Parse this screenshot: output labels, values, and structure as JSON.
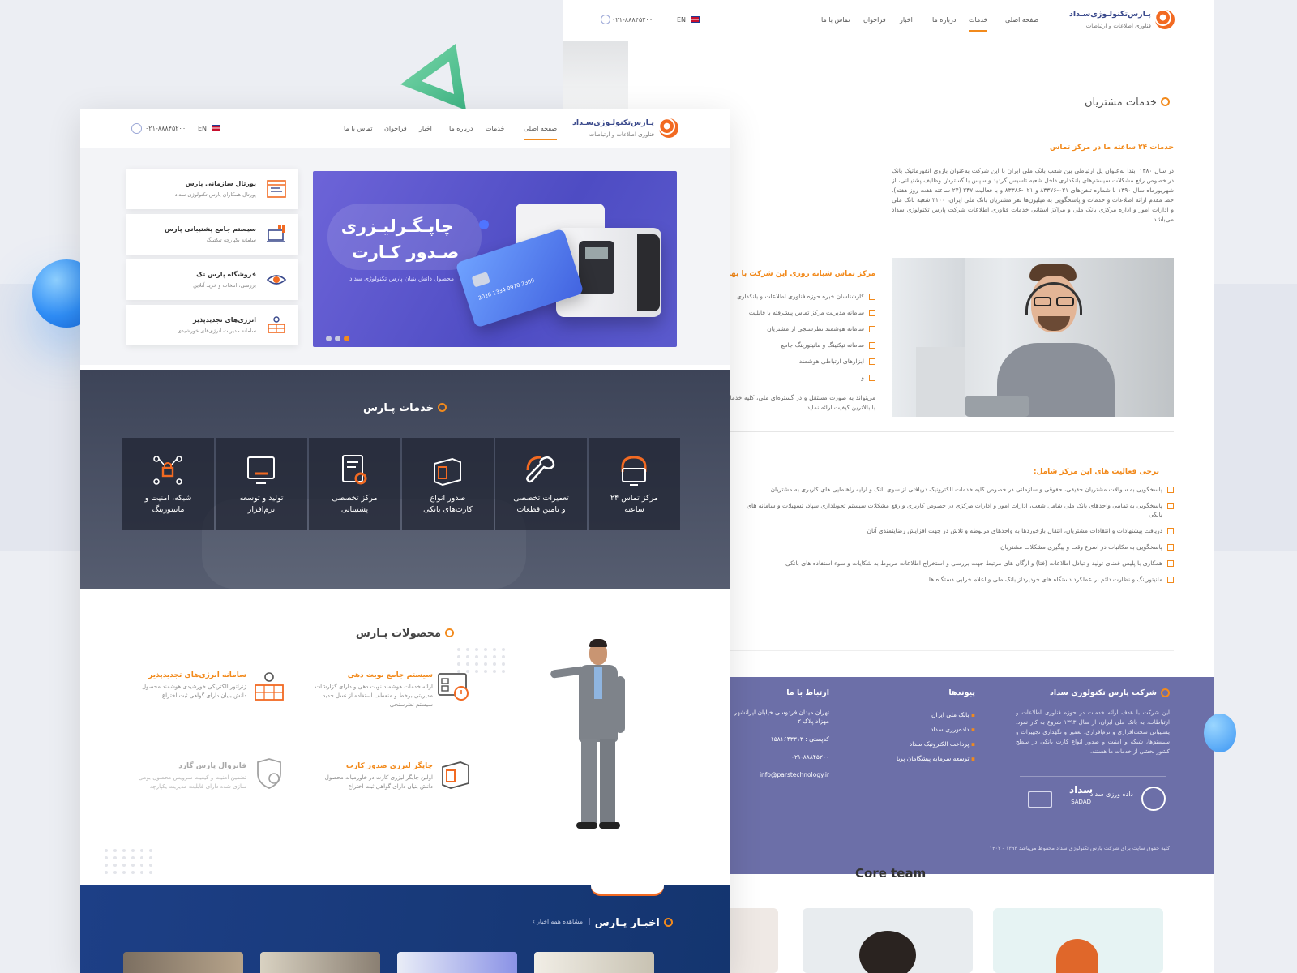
{
  "back": {
    "brand": {
      "name": "پـارس‌تکنولـوژی‌سـداد",
      "tagline": "فناوری اطلاعات و ارتباطات"
    },
    "nav": [
      "صفحه اصلی",
      "خدمات",
      "درباره ما",
      "اخبار",
      "فراخوان",
      "تماس با ما"
    ],
    "lang": "EN",
    "phone": "۰۲۱-۸۸۸۴۵۲۰۰",
    "section_title": "خدمات مشتریان",
    "subtitle": "خدمات ۲۴ ساعته ما در مرکز تماس",
    "paragraph": "در سال ۱۳۸۰ ابتدا به‌عنوان پل ارتباطی بین شعب بانک ملی ایران با این شرکت به‌عنوان بازوی انفورماتیک بانک در خصوص رفع مشکلات سیستم‌های بانکداری داخل شعبه تاسیس گردید و سپس با گسترش وظایف پشتیبانی، از شهریورماه سال ۱۳۹۰ با شماره تلفن‌های ۰۲۱-۸۳۳۷۶ و ۰۲۱-۸۳۳۸۶ و با فعالیت ۲۴۷ (۲۴ ساعته هفت روز هفته)، خط مقدم ارائه اطلاعات و خدمات و پاسخگویی به میلیون‌ها نفر مشتریان بانک ملی ایران، ۳۱۰۰ شعبه بانک ملی و ادارات امور و اداره مرکزی بانک ملی و مراکز استانی خدمات فناوری اطلاعات شرکت پارس تکنولوژی سداد می‌باشد.",
    "center_title": "مرکز تماس شبانه روزی این شرکت با بهره گیری",
    "center_items": [
      "کارشناسان خبره حوزه فناوری اطلاعات و بانکداری",
      "سامانه مدیریت مرکز تماس پیشرفته با قابلیت",
      "سامانه هوشمند نظرسنجی از مشتریان",
      "سامانه تیکتینگ و مانیتورینگ جامع",
      "ابزارهای ارتباطی هوشمند",
      "و..."
    ],
    "center_note": "می‌تواند به صورت مستقل و در گستره‌ای ملی، کلیه خدمات را با بالاترین کیفیت ارائه نماید.",
    "activities_title": "برخی فعالیت های این مرکز شامل:",
    "activities": [
      "پاسخگویی به سوالات مشتریان حقیقی، حقوقی و سازمانی در خصوص کلیه خدمات الکترونیک دریافتی از سوی بانک و ارایه راهنمایی های کاربری به مشتریان",
      "پاسخگویی به تمامی واحدهای بانک ملی شامل شعب، ادارات امور و ادارات مرکزی در خصوص کاربری و رفع مشکلات سیستم تحویلداری سپاد، تسهیلات و سامانه های بانکی",
      "دریافت پیشنهادات و انتقادات مشتریان، انتقال بازخوردها به واحدهای مربوطه و تلاش در جهت افزایش رضایتمندی آنان",
      "پاسخگویی به مکاتبات در اسرع وقت و پیگیری مشکلات مشتریان",
      "همکاری با پلیس فضای تولید و تبادل اطلاعات (فتا) و ارگان های مرتبط جهت بررسی و استخراج اطلاعات مربوط به شکایات و سوء استفاده های بانکی",
      "مانیتورینگ و نظارت دائم بر عملکرد دستگاه های خودپرداز بانک ملی و اعلام خرابی دستگاه ها"
    ],
    "footer": {
      "company_title": "شرکت پارس تکنولوژی سداد",
      "company_text": "این شرکت با هدف ارائه خدمات در حوزه فناوری اطلاعات و ارتباطات، به بانک ملی ایران، از سال ۱۳۹۳ شروع به کار نمود. پشتیبانی سخت‌افزاری و نرم‌افزاری، تعمیر و نگهداری تجهیزات و سیستم‌ها، شبکه و امنیت و صدور انواع کارت بانکی در سطح کشور بخشی از خدمات ما هستند.",
      "links_title": "پیوندها",
      "links": [
        "بانک ملی ایران",
        "داده‌ورزی سداد",
        "پرداخت الکترونیک سداد",
        "توسعه سرمایه پیشگامان پویا"
      ],
      "contact_title": "ارتباط با ما",
      "address": "تهران میدان فردوسی خیابان ایرانشهر مهزاد پلاک ۲",
      "postal": "کدپستی : ۱۵۸۱۶۴۳۳۱۳",
      "phone": "۰۲۱-۸۸۸۴۵۲۰۰",
      "email": "info@parstechnology.ir",
      "logos": [
        "سداد",
        "SADAD",
        "داده ورزی سداد"
      ],
      "copyright": "کلیه حقوق سایت برای شرکت پارس تکنولوژی سداد محفوظ می‌باشد ۱۳۹۳ - ۱۴۰۲"
    },
    "team_title": "Core team"
  },
  "front": {
    "brand": {
      "name": "پـارس‌تکنولـوژی‌سـداد",
      "tagline": "فناوری اطلاعات و ارتباطات"
    },
    "nav": [
      "صفحه اصلی",
      "خدمات",
      "درباره ما",
      "اخبار",
      "فراخوان",
      "تماس با ما"
    ],
    "lang": "EN",
    "phone": "۰۲۱-۸۸۸۴۵۲۰۰",
    "slider": {
      "title1": "چاپـگـرلیـزری",
      "title2": "صـدور کـارت",
      "caption": "محصول دانش بنیان پارس تکنولوژی سداد",
      "card_number": "2020 1334 0970 2309"
    },
    "side_cards": [
      {
        "title": "پورتال سازمانی پارس",
        "desc": "پورتال همکاران پارس تکنولوژی سداد",
        "icon": "portal-icon"
      },
      {
        "title": "سیستم جامع پشتیبانی پارس",
        "desc": "سامانه یکپارچه تیکتینگ",
        "icon": "support-system-icon"
      },
      {
        "title": "فروشگاه پارس تک",
        "desc": "بررسی، انتخاب و خرید آنلاین",
        "icon": "eye-icon"
      },
      {
        "title": "انرژی‌های تجدیدپذیر",
        "desc": "سامانه مدیریت انرژی‌های خورشیدی",
        "icon": "solar-icon"
      }
    ],
    "services_title": "خدمات پـارس",
    "services": [
      {
        "line1": "مرکز تماس ۲۴",
        "line2": "ساعته",
        "icon": "headset-icon"
      },
      {
        "line1": "تعمیرات تخصصی",
        "line2": "و تامین قطعات",
        "icon": "wrench-icon"
      },
      {
        "line1": "صدور انواع",
        "line2": "کارت‌های بانکی",
        "icon": "card-printer-icon"
      },
      {
        "line1": "مرکز تخصصی",
        "line2": "پشتیبانی",
        "icon": "document-gear-icon"
      },
      {
        "line1": "تولید و توسعه",
        "line2": "نرم‌افزار",
        "icon": "monitor-icon"
      },
      {
        "line1": "شبکه، امنیت و",
        "line2": "مانیتورینگ",
        "icon": "network-lock-icon"
      }
    ],
    "products_title": "محصولات پـارس",
    "products": [
      {
        "title": "سیستم جامع نوبت دهی",
        "desc": "ارائه خدمات هوشمند نوبت دهی و دارای گزارشات مدیریتی برخط و منعطف استفاده از نسل جدید سیستم نظرسنجی"
      },
      {
        "title": "سامانه انرژی‌های تجدیدپذیر",
        "desc": "ژنراتور الکتریکی خورشیدی هوشمند محصول دانش بنیان دارای گواهی ثبت اختراع"
      },
      {
        "title": "چاپگر لیزری صدور کارت",
        "desc": "اولین چاپگر لیزری کارت در خاورمیانه محصول دانش بنیان دارای گواهی ثبت اختراع"
      },
      {
        "title": "فایروال پارس گارد",
        "desc": "تضمین امنیت و کیفیت سرویس محصول بومی سازی شده دارای قابلیت مدیریت یکپارچه"
      }
    ],
    "news_title": "اخبـار پـارس",
    "news_all": "مشاهده همه اخبار"
  }
}
